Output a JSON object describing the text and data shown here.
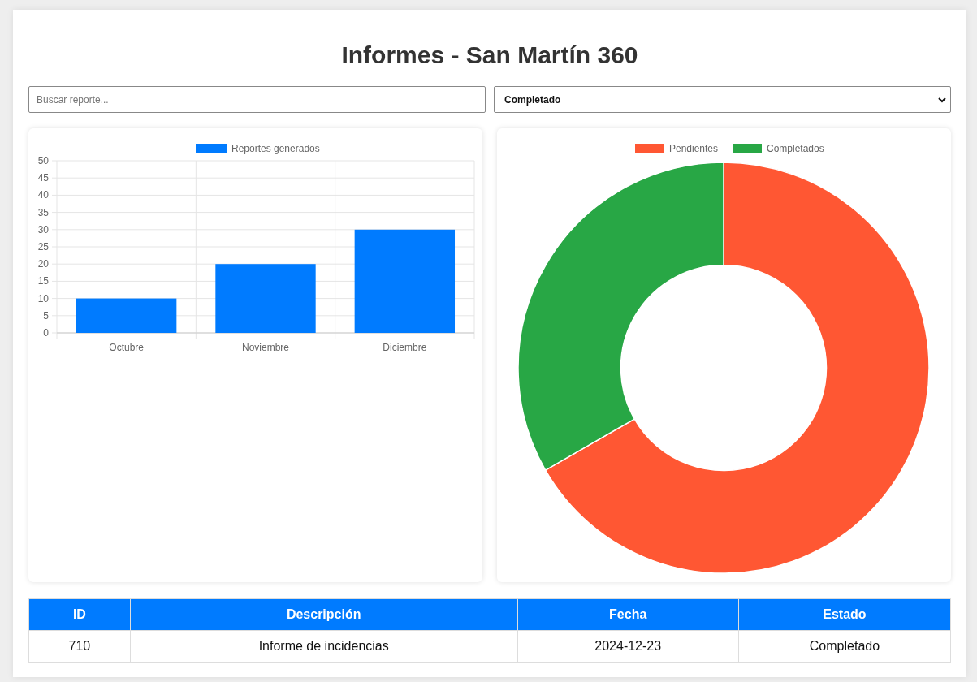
{
  "title": "Informes - San Martín 360",
  "search": {
    "placeholder": "Buscar reporte..."
  },
  "status_filter": {
    "value": "Completado"
  },
  "bar_chart": {
    "chart_data": {
      "type": "bar",
      "categories": [
        "Octubre",
        "Noviembre",
        "Diciembre"
      ],
      "series": [
        {
          "name": "Reportes generados",
          "color": "#007bff",
          "values": [
            10,
            20,
            30
          ]
        }
      ],
      "legend": "top",
      "grid": true,
      "ylim": [
        0,
        50
      ],
      "yticks": [
        0,
        5,
        10,
        15,
        20,
        25,
        30,
        35,
        40,
        45,
        50
      ]
    }
  },
  "donut_chart": {
    "chart_data": {
      "type": "donut",
      "categories": [
        "Pendientes",
        "Completados"
      ],
      "values": [
        66.7,
        33.3
      ],
      "colors": [
        "#ff5733",
        "#28a745"
      ],
      "legend": "top"
    }
  },
  "table": {
    "columns": [
      "ID",
      "Descripción",
      "Fecha",
      "Estado"
    ],
    "rows": [
      [
        "710",
        "Informe de incidencias",
        "2024-12-23",
        "Completado"
      ]
    ]
  }
}
